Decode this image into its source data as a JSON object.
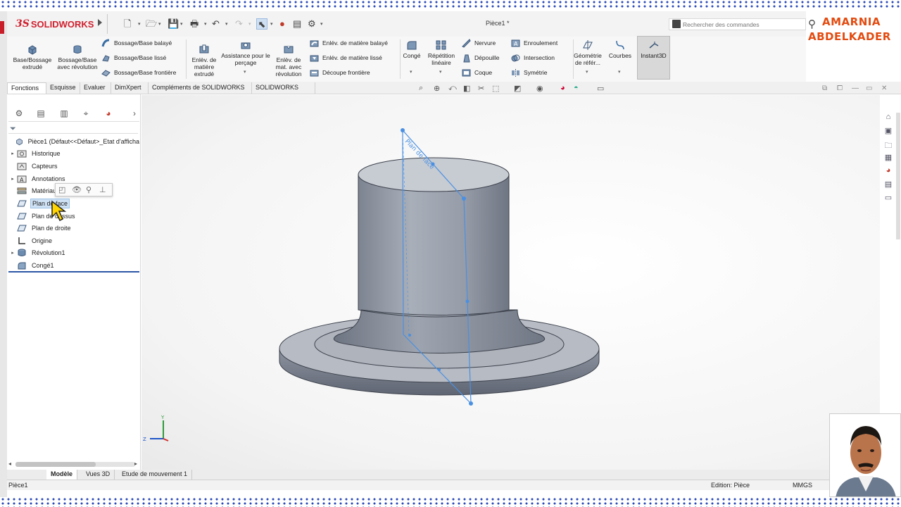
{
  "app": {
    "brand": "SOLIDWORKS",
    "doc_title": "Pièce1 *",
    "search_placeholder": "Rechercher des commandes",
    "author_line1": "AMARNIA",
    "author_line2": "ABDELKADER"
  },
  "ribbon": {
    "base_extrude": "Base/Bossage extrudé",
    "base_revolve": "Bossage/Base avec révolution",
    "sweep_boss": "Bossage/Base balayé",
    "loft_boss": "Bossage/Base lissé",
    "boundary_boss": "Bossage/Base frontière",
    "cut_extrude": "Enlèv. de matière extrudé",
    "hole_wizard": "Assistance pour le perçage",
    "cut_revolve": "Enlèv. de mat. avec révolution",
    "swept_cut": "Enlév. de matière balayé",
    "lofted_cut": "Enlév. de matière lissé",
    "boundary_cut": "Découpe frontière",
    "fillet": "Congé",
    "linear_pattern": "Répétition linéaire",
    "rib": "Nervure",
    "draft": "Dépouille",
    "shell": "Coque",
    "wrap": "Enroulement",
    "intersect": "Intersection",
    "mirror": "Symétrie",
    "ref_geometry": "Géométrie de référ...",
    "curves": "Courbes",
    "instant3d": "Instant3D"
  },
  "command_tabs": [
    "Fonctions",
    "Esquisse",
    "Evaluer",
    "DimXpert",
    "Compléments de SOLIDWORKS",
    "SOLIDWORKS MBD"
  ],
  "tree": {
    "root": "Pièce1 (Défaut<<Défaut>_Etat d'afficha",
    "items": [
      {
        "label": "Historique",
        "expand": "▸"
      },
      {
        "label": "Capteurs",
        "expand": ""
      },
      {
        "label": "Annotations",
        "expand": "▸"
      },
      {
        "label": "Matériau",
        "expand": ""
      },
      {
        "label": "Plan de face",
        "expand": ""
      },
      {
        "label": "Plan de dessus",
        "expand": ""
      },
      {
        "label": "Plan de droite",
        "expand": ""
      },
      {
        "label": "Origine",
        "expand": ""
      },
      {
        "label": "Révolution1",
        "expand": "▸"
      },
      {
        "label": "Congé1",
        "expand": ""
      }
    ]
  },
  "viewport": {
    "plane_label": "Plan de face",
    "triad_y": "Y",
    "triad_z": "Z"
  },
  "bottom_tabs": [
    "Modèle",
    "Vues 3D",
    "Etude de mouvement 1"
  ],
  "status": {
    "left": "Pièce1",
    "mode": "Edition: Pièce",
    "units": "MMGS"
  },
  "colors": {
    "accent_red": "#d0202e",
    "brand_orange": "#e34b10",
    "selection_blue": "#cfe2f5",
    "plane_blue": "#4a90e2",
    "part_grey": "#8f96a3"
  }
}
